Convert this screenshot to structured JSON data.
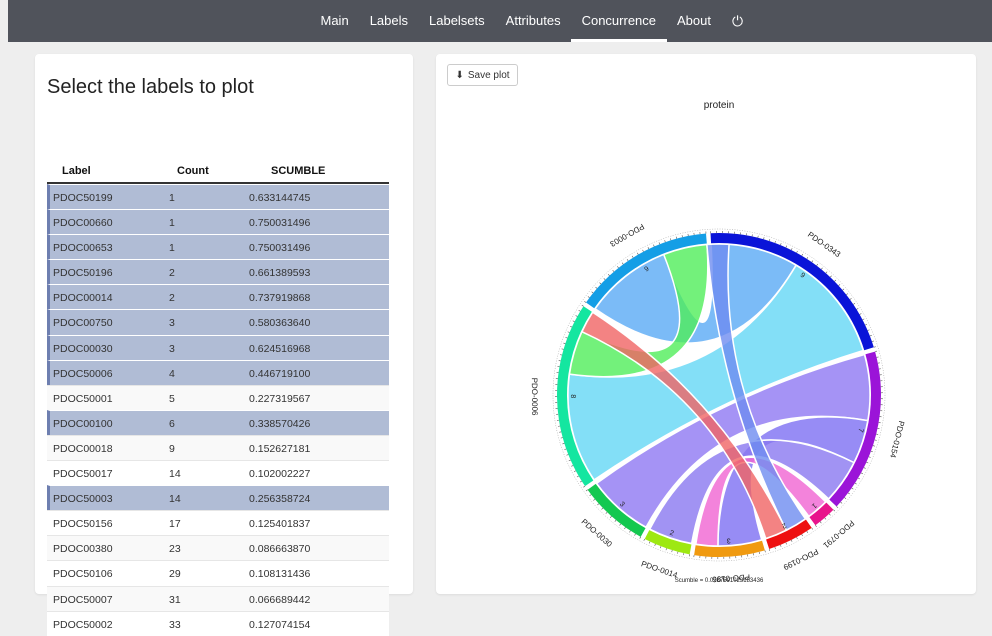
{
  "nav": {
    "items": [
      "Main",
      "Labels",
      "Labelsets",
      "Attributes",
      "Concurrence",
      "About"
    ],
    "active": "Concurrence",
    "power_icon": "⏻"
  },
  "left": {
    "title": "Select the labels to plot",
    "columns": {
      "label": "Label",
      "count": "Count",
      "scumble": "SCUMBLE"
    },
    "rows": [
      {
        "label": "PDOC50199",
        "count": "1",
        "scumble": "0.633144745",
        "selected": true
      },
      {
        "label": "PDOC00660",
        "count": "1",
        "scumble": "0.750031496",
        "selected": true
      },
      {
        "label": "PDOC00653",
        "count": "1",
        "scumble": "0.750031496",
        "selected": true
      },
      {
        "label": "PDOC50196",
        "count": "2",
        "scumble": "0.661389593",
        "selected": true
      },
      {
        "label": "PDOC00014",
        "count": "2",
        "scumble": "0.737919868",
        "selected": true
      },
      {
        "label": "PDOC00750",
        "count": "3",
        "scumble": "0.580363640",
        "selected": true
      },
      {
        "label": "PDOC00030",
        "count": "3",
        "scumble": "0.624516968",
        "selected": true
      },
      {
        "label": "PDOC50006",
        "count": "4",
        "scumble": "0.446719100",
        "selected": true
      },
      {
        "label": "PDOC50001",
        "count": "5",
        "scumble": "0.227319567",
        "selected": false
      },
      {
        "label": "PDOC00100",
        "count": "6",
        "scumble": "0.338570426",
        "selected": true
      },
      {
        "label": "PDOC00018",
        "count": "9",
        "scumble": "0.152627181",
        "selected": false
      },
      {
        "label": "PDOC50017",
        "count": "14",
        "scumble": "0.102002227",
        "selected": false
      },
      {
        "label": "PDOC50003",
        "count": "14",
        "scumble": "0.256358724",
        "selected": true
      },
      {
        "label": "PDOC50156",
        "count": "17",
        "scumble": "0.125401837",
        "selected": false
      },
      {
        "label": "PDOC00380",
        "count": "23",
        "scumble": "0.086663870",
        "selected": false
      },
      {
        "label": "PDOC50106",
        "count": "29",
        "scumble": "0.108131436",
        "selected": false
      },
      {
        "label": "PDOC50007",
        "count": "31",
        "scumble": "0.066689442",
        "selected": false
      },
      {
        "label": "PDOC50002",
        "count": "33",
        "scumble": "0.127074154",
        "selected": false
      }
    ]
  },
  "right": {
    "save_label": "Save plot",
    "save_icon": "download-icon"
  },
  "chart_data": {
    "type": "chord",
    "title": "protein",
    "subtitle": "Scumble = 0.0287591023183436",
    "sectors": [
      {
        "name": "PDO-0343",
        "value": 9,
        "color": "#0a14d8"
      },
      {
        "name": "PDO-0154",
        "value": 7,
        "color": "#9b14d8"
      },
      {
        "name": "PDO-0791",
        "value": 1,
        "color": "#e8148c"
      },
      {
        "name": "PDO-0199",
        "value": 2,
        "color": "#ee1010"
      },
      {
        "name": "PDO-0196",
        "value": 3,
        "color": "#f09a10"
      },
      {
        "name": "PDO-0014",
        "value": 2,
        "color": "#9ee812"
      },
      {
        "name": "PDO-0030",
        "value": 3,
        "color": "#14c850"
      },
      {
        "name": "PDO-0006",
        "value": 8,
        "color": "#14e6a0"
      },
      {
        "name": "PDO-0003",
        "value": 6,
        "color": "#149ee6"
      }
    ],
    "links": [
      {
        "from": "PDO-0343",
        "to": "PDO-0003",
        "value": 4,
        "color": "#5aaaf5"
      },
      {
        "from": "PDO-0343",
        "to": "PDO-0006",
        "value": 5,
        "color": "#64d7f5"
      },
      {
        "from": "PDO-0003",
        "to": "PDO-0006",
        "value": 2,
        "color": "#50ee5a"
      },
      {
        "from": "PDO-0154",
        "to": "PDO-0030",
        "value": 3,
        "color": "#8f78f2"
      },
      {
        "from": "PDO-0154",
        "to": "PDO-0196",
        "value": 2,
        "color": "#7d6ff2"
      },
      {
        "from": "PDO-0154",
        "to": "PDO-0014",
        "value": 2,
        "color": "#8a78f0"
      },
      {
        "from": "PDO-0791",
        "to": "PDO-0196",
        "value": 1,
        "color": "#f064d2"
      },
      {
        "from": "PDO-0199",
        "to": "PDO-0003",
        "value": 1,
        "color": "#6e8cf0"
      },
      {
        "from": "PDO-0199",
        "to": "PDO-0006",
        "value": 1,
        "color": "#f06464"
      }
    ]
  }
}
